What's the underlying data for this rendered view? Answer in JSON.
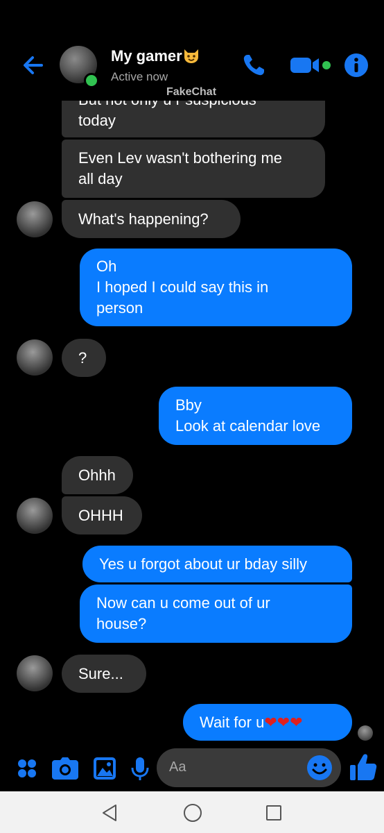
{
  "header": {
    "contact_name": "My gamer",
    "status": "Active now",
    "watermark": "FakeChat"
  },
  "messages": [
    {
      "id": 0,
      "side": "in",
      "lines": [
        "But not only u r suspicious",
        "today"
      ]
    },
    {
      "id": 1,
      "side": "in",
      "lines": [
        "Even Lev wasn't bothering me",
        "all day"
      ]
    },
    {
      "id": 2,
      "side": "in",
      "lines": [
        "What's happening?"
      ]
    },
    {
      "id": 3,
      "side": "out",
      "lines": [
        "Oh",
        "I hoped I could say this in",
        "person"
      ]
    },
    {
      "id": 4,
      "side": "in",
      "lines": [
        "?"
      ]
    },
    {
      "id": 5,
      "side": "out",
      "lines": [
        "Bby",
        "Look at calendar love"
      ]
    },
    {
      "id": 6,
      "side": "in",
      "lines": [
        "Ohhh"
      ]
    },
    {
      "id": 7,
      "side": "in",
      "lines": [
        "OHHH"
      ]
    },
    {
      "id": 8,
      "side": "out",
      "lines": [
        "Yes u forgot about ur bday silly"
      ]
    },
    {
      "id": 9,
      "side": "out",
      "lines": [
        "Now can u come out of ur",
        "house?"
      ]
    },
    {
      "id": 10,
      "side": "in",
      "lines": [
        "Sure..."
      ]
    },
    {
      "id": 11,
      "side": "out",
      "text": "Wait for u",
      "hearts": "❤❤❤"
    }
  ],
  "composer": {
    "placeholder": "Aa"
  },
  "colors": {
    "accent": "#0a7cff",
    "incoming_bubble": "#303030",
    "outgoing_bubble": "#0a7cff",
    "online": "#31c251",
    "background": "#000000"
  },
  "icons": {
    "back": "arrow-left-icon",
    "call": "phone-icon",
    "video": "video-camera-icon",
    "info": "info-icon",
    "menu": "four-dots-icon",
    "camera": "camera-icon",
    "gallery": "image-icon",
    "mic": "microphone-icon",
    "emoji": "smiley-icon",
    "like": "thumbs-up-icon",
    "nav_back": "triangle-back-icon",
    "nav_home": "circle-home-icon",
    "nav_recent": "square-recents-icon"
  }
}
